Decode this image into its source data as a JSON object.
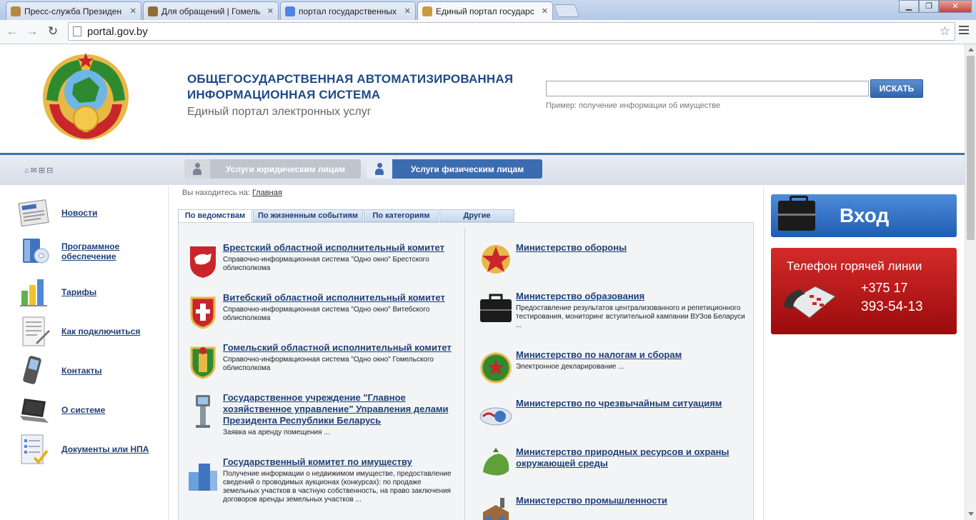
{
  "browser": {
    "tabs": [
      {
        "label": "Пресс-служба Президен",
        "fav": "#b58a3c"
      },
      {
        "label": "Для обращений | Гомель",
        "fav": "#8f6d37"
      },
      {
        "label": "портал государственных",
        "fav": "#4f84e6"
      },
      {
        "label": "Единый портал государс",
        "fav": "#c99a3d"
      }
    ],
    "url": "portal.gov.by"
  },
  "header": {
    "title_line1": "ОБЩЕГОСУДАРСТВЕННАЯ АВТОМАТИЗИРОВАННАЯ",
    "title_line2": "ИНФОРМАЦИОННАЯ СИСТЕМА",
    "subtitle": "Единый портал электронных услуг",
    "search_button": "ИСКАТЬ",
    "search_value": "",
    "hint_prefix": "Пример:",
    "hint_text": "получение информации об имуществе"
  },
  "services": {
    "legal": "Услуги юридическим лицам",
    "physical": "Услуги физическим лицам"
  },
  "band_icons": "⌂✉⊞⊟",
  "left_nav": [
    {
      "label": "Новости",
      "icon": "newspaper-icon"
    },
    {
      "label": "Программное\nобеспечение",
      "icon": "software-icon"
    },
    {
      "label": "Тарифы",
      "icon": "chart-icon"
    },
    {
      "label": "Как подключиться",
      "icon": "document-icon"
    },
    {
      "label": "Контакты",
      "icon": "phone-icon"
    },
    {
      "label": "О системе",
      "icon": "laptop-icon"
    },
    {
      "label": "Документы или НПА",
      "icon": "checklist-icon"
    }
  ],
  "breadcrumb": {
    "prefix": "Вы находитесь на:",
    "link": "Главная"
  },
  "content_tabs": [
    "По ведомствам",
    "По жизненным событиям",
    "По категориям",
    "Другие"
  ],
  "orgs_left": [
    {
      "name": "Брестский областной исполнительный комитет",
      "desc": "Справочно-информационная система \"Одно окно\" Брестского облисполкома",
      "icon": "brest-coat-icon"
    },
    {
      "name": "Витебский областной исполнительный комитет",
      "desc": "Справочно-информационная система \"Одно окно\" Витебского облисполкома",
      "icon": "vitebsk-coat-icon"
    },
    {
      "name": "Гомельский областной исполнительный комитет",
      "desc": "Справочно-информационная система \"Одно окно\" Гомельского облисполкома",
      "icon": "gomel-coat-icon"
    },
    {
      "name": "Государственное учреждение \"Главное хозяйственное управление\" Управления делами Президента Республики Беларусь",
      "desc": "Заявка на аренду помещения ...",
      "icon": "kiosk-icon"
    },
    {
      "name": "Государственный комитет по имуществу",
      "desc": "Получение информации о недвижимом имуществе, предоставление сведений о проводимых аукционах (конкурсах): по продаже земельных участков в частную собственность, на право заключения договоров аренды земельных участков ...",
      "icon": "buildings-icon"
    }
  ],
  "orgs_right": [
    {
      "name": "Министерство обороны",
      "desc": "",
      "icon": "army-star-icon"
    },
    {
      "name": "Министерство образования",
      "desc": "Предоставление результатов централизованного и репетиционного тестирования, мониторинг вступительной кампании ВУЗов Беларуси ...",
      "icon": "briefcase-icon"
    },
    {
      "name": "Министерство по налогам и сборам",
      "desc": "Электронное декларирование ...",
      "icon": "tax-emblem-icon"
    },
    {
      "name": "Министерство по чрезвычайным ситуациям",
      "desc": "",
      "icon": "emergency-icon"
    },
    {
      "name": "Министерство природных ресурсов и охраны окружающей среды",
      "desc": "",
      "icon": "nature-icon"
    },
    {
      "name": "Министерство промышленности",
      "desc": "",
      "icon": "factory-icon"
    }
  ],
  "login": {
    "label": "Вход"
  },
  "hotline": {
    "title": "Телефон горячей линии",
    "line1": "+375 17",
    "line2": "393-54-13"
  }
}
